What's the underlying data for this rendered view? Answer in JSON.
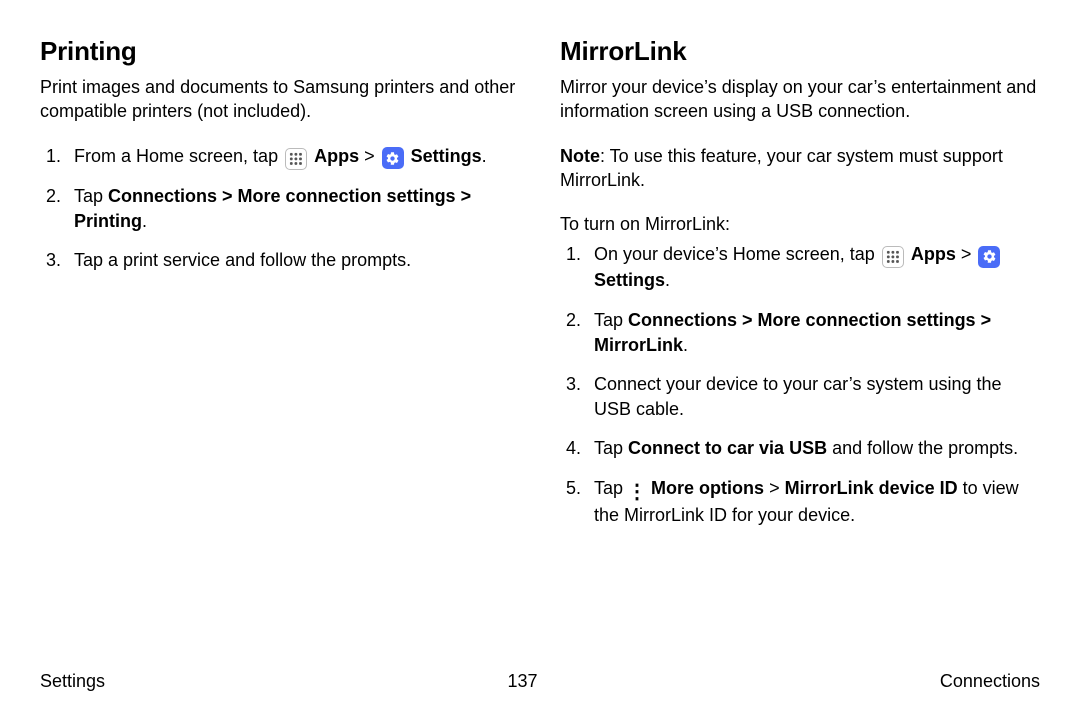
{
  "left": {
    "heading": "Printing",
    "intro": "Print images and documents to Samsung printers and other compatible printers (not included).",
    "step1_a": "From a Home screen, tap ",
    "step1_apps": "Apps",
    "step1_chev": " > ",
    "step1_settings": "Settings",
    "step1_end": ".",
    "step2_a": "Tap ",
    "step2_path": "Connections > More connection settings > Printing",
    "step2_end": ".",
    "step3": "Tap a print service and follow the prompts."
  },
  "right": {
    "heading": "MirrorLink",
    "intro": "Mirror your device’s display on your car’s entertainment and information screen using a USB connection.",
    "note_label": "Note",
    "note_body": ": To use this feature, your car system must support MirrorLink.",
    "lead": "To turn on MirrorLink:",
    "s1_a": "On your device’s Home screen, tap ",
    "s1_apps": "Apps",
    "s1_chev": " > ",
    "s1_settings": "Settings",
    "s1_end": ".",
    "s2_a": "Tap ",
    "s2_path": "Connections > More connection settings > MirrorLink",
    "s2_end": ".",
    "s3": "Connect your device to your car’s system using the USB cable.",
    "s4_a": "Tap ",
    "s4_bold": "Connect to car via USB",
    "s4_b": " and follow the prompts.",
    "s5_a": "Tap ",
    "s5_more": "More options",
    "s5_chev": " > ",
    "s5_mid": "MirrorLink device ID",
    "s5_b": " to view the MirrorLink ID for your device."
  },
  "footer": {
    "left": "Settings",
    "center": "137",
    "right": "Connections"
  },
  "icons": {
    "apps": "apps-icon",
    "settings": "settings-icon",
    "more": "more-options-icon"
  }
}
